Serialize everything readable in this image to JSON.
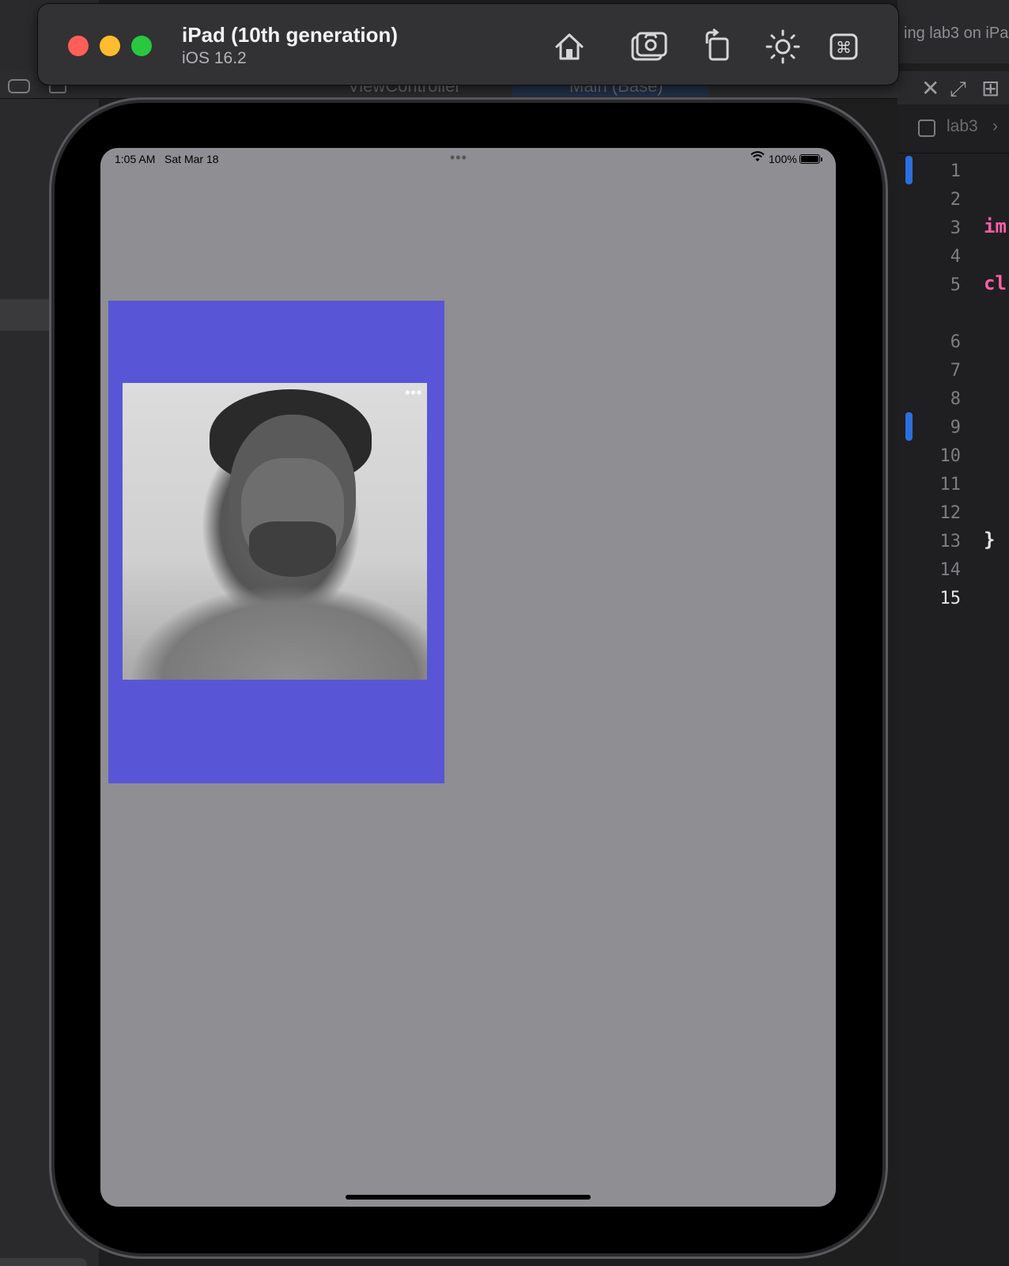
{
  "simulator": {
    "device_name": "iPad (10th generation)",
    "os_version": "iOS 16.2",
    "toolbar_buttons": [
      "home-icon",
      "screenshot-icon",
      "rotate-icon",
      "appearance-icon",
      "command-icon"
    ]
  },
  "status_bar": {
    "time": "1:05 AM",
    "date": "Sat Mar 18",
    "multitask_dots": "•••",
    "wifi": "⌔",
    "battery": "100%"
  },
  "app_view": {
    "background_color": "#8e8e93",
    "container_color": "#5856d6",
    "photo_menu": "•••"
  },
  "xcode": {
    "run_status": "ing lab3 on iPa",
    "tab_ghost_1": "ViewController",
    "tab_ghost_2": "Main (Base)",
    "breadcrumb": "lab3",
    "line_numbers": [
      "1",
      "2",
      "3",
      "4",
      "5",
      "6",
      "7",
      "8",
      "9",
      "10",
      "11",
      "12",
      "13",
      "14",
      "15"
    ],
    "code_fragments": {
      "line3": "im",
      "line5": "cl",
      "line13": "}"
    }
  }
}
